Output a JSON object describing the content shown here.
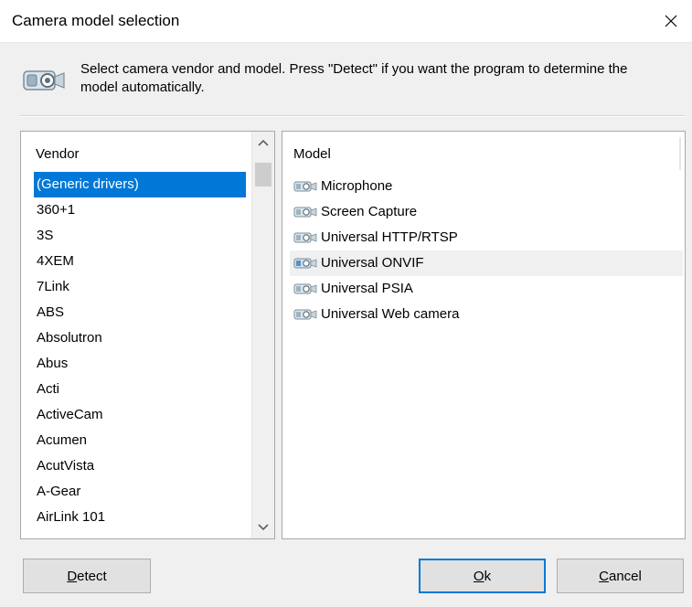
{
  "window": {
    "title": "Camera model selection"
  },
  "info": {
    "text": "Select camera vendor and model. Press \"Detect\" if you want the program to determine the model automatically."
  },
  "vendor": {
    "header": "Vendor",
    "items": [
      "(Generic drivers)",
      "360+1",
      "3S",
      "4XEM",
      "7Link",
      "ABS",
      "Absolutron",
      "Abus",
      "Acti",
      "ActiveCam",
      "Acumen",
      "AcutVista",
      "A-Gear",
      "AirLink 101"
    ],
    "selected": "(Generic drivers)"
  },
  "model": {
    "header": "Model",
    "items": [
      "Microphone",
      "Screen Capture",
      "Universal HTTP/RTSP",
      "Universal ONVIF",
      "Universal PSIA",
      "Universal Web camera"
    ],
    "highlighted": "Universal ONVIF"
  },
  "buttons": {
    "detect": {
      "accel": "D",
      "rest": "etect"
    },
    "ok": {
      "accel": "O",
      "rest": "k"
    },
    "cancel": {
      "accel": "C",
      "rest": "ancel"
    }
  },
  "colors": {
    "selection": "#0078d7",
    "default_button_border": "#0078d7"
  }
}
